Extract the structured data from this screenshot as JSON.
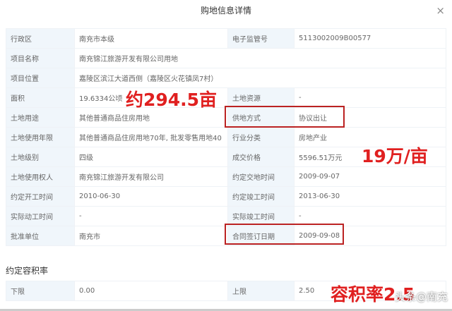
{
  "dialog": {
    "title": "购地信息详情",
    "close": "×"
  },
  "rows": [
    {
      "l1": "行政区",
      "v1": "南充市本级",
      "l2": "电子监管号",
      "v2": "5113002009B00577"
    },
    {
      "l1": "项目名称",
      "v1": "南充锦江旅游开发有限公司用地"
    },
    {
      "l1": "项目位置",
      "v1": "嘉陵区滨江大道西侧（嘉陵区火花镇凤7村）"
    },
    {
      "l1": "面积",
      "v1": "19.6334公顷",
      "l2": "土地资源",
      "v2": "-"
    },
    {
      "l1": "土地用途",
      "v1": "其他普通商品住房用地",
      "l2": "供地方式",
      "v2": "协议出让"
    },
    {
      "l1": "土地使用年限",
      "v1": "其他普通商品住房用地70年, 批发零售用地40",
      "l2": "行业分类",
      "v2": "房地产业"
    },
    {
      "l1": "土地级别",
      "v1": "四级",
      "l2": "成交价格",
      "v2": "5596.51万元"
    },
    {
      "l1": "土地使用权人",
      "v1": "南充锦江旅游开发有限公司",
      "l2": "约定交地时间",
      "v2": "2009-09-07"
    },
    {
      "l1": "约定开工时间",
      "v1": "2010-06-30",
      "l2": "约定竣工时间",
      "v2": "2013-06-30"
    },
    {
      "l1": "实际动工时间",
      "v1": "-",
      "l2": "实际竣工时间",
      "v2": "-"
    },
    {
      "l1": "批准单位",
      "v1": "南充市",
      "l2": "合同签订日期",
      "v2": "2009-09-08"
    }
  ],
  "far": {
    "title": "约定容积率",
    "l1": "下限",
    "v1": "0.00",
    "l2": "上限",
    "v2": "2.50"
  },
  "annotations": {
    "area": "约294.5亩",
    "price": "19万/亩",
    "far": "容积率2.5"
  },
  "watermark": "头条@南充"
}
